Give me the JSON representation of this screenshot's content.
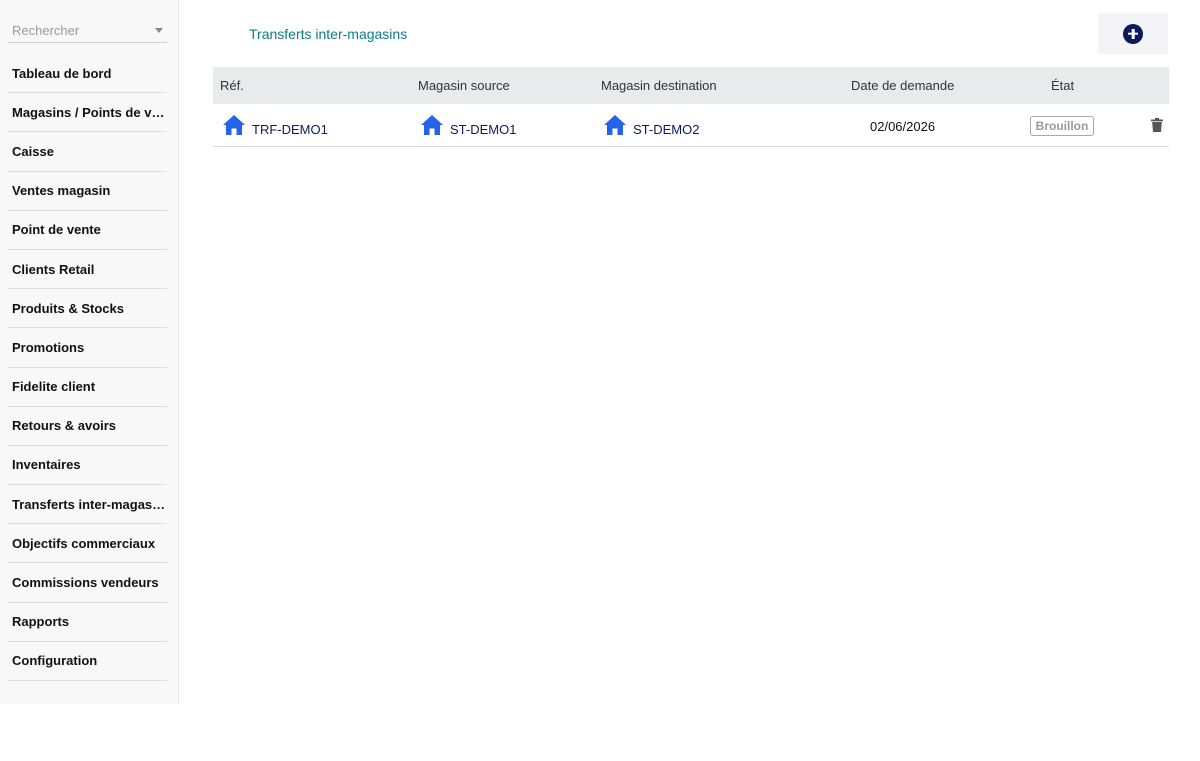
{
  "sidebar": {
    "search_placeholder": "Rechercher",
    "items": [
      {
        "label": "Tableau de bord"
      },
      {
        "label": "Magasins / Points de vente"
      },
      {
        "label": "Caisse"
      },
      {
        "label": "Ventes magasin"
      },
      {
        "label": "Point de vente"
      },
      {
        "label": "Clients Retail"
      },
      {
        "label": "Produits & Stocks"
      },
      {
        "label": "Promotions"
      },
      {
        "label": "Fidelite client"
      },
      {
        "label": "Retours & avoirs"
      },
      {
        "label": "Inventaires"
      },
      {
        "label": "Transferts inter-magasins"
      },
      {
        "label": "Objectifs commerciaux"
      },
      {
        "label": "Commissions vendeurs"
      },
      {
        "label": "Rapports"
      },
      {
        "label": "Configuration"
      }
    ]
  },
  "header": {
    "title": "Transferts inter-magasins",
    "add_icon": "plus-circle-icon"
  },
  "table": {
    "columns": [
      "Réf.",
      "Magasin source",
      "Magasin destination",
      "Date de demande",
      "État"
    ],
    "rows": [
      {
        "ref": "TRF-DEMO1",
        "source": "ST-DEMO1",
        "destination": "ST-DEMO2",
        "date": "02/06/2026",
        "status": "Brouillon"
      }
    ]
  },
  "colors": {
    "accent_title": "#0e7c86",
    "link_text": "#0d1a5c",
    "home_icon": "#2563eb",
    "add_button": "#0d1a5c"
  }
}
